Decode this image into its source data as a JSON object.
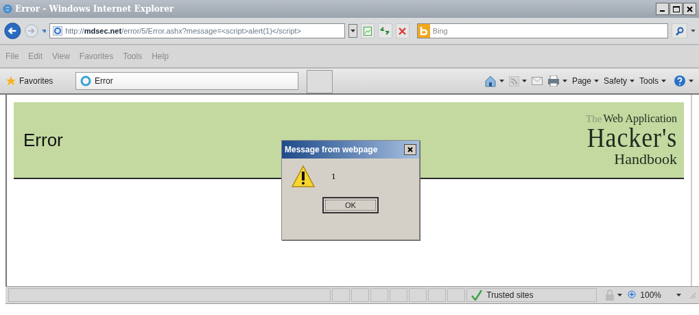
{
  "window": {
    "title": "Error - Windows Internet Explorer"
  },
  "address_bar": {
    "url": "http://**mdsec.net**/error/5/Error.ashx?message=<script>alert(1)</script>"
  },
  "search": {
    "placeholder": "Bing"
  },
  "menu": [
    "File",
    "Edit",
    "View",
    "Favorites",
    "Tools",
    "Help"
  ],
  "favorites_bar": {
    "label": "Favorites",
    "tab": "Error"
  },
  "command_bar": [
    "Page",
    "Safety",
    "Tools"
  ],
  "page": {
    "heading": "Error",
    "logo": [
      "The",
      "Web Application",
      "Hacker's",
      "Handbook"
    ]
  },
  "dialog": {
    "title": "Message from webpage",
    "message": "1",
    "button": "OK"
  },
  "status_bar": {
    "zone": "Trusted sites",
    "zoom": "100%"
  }
}
